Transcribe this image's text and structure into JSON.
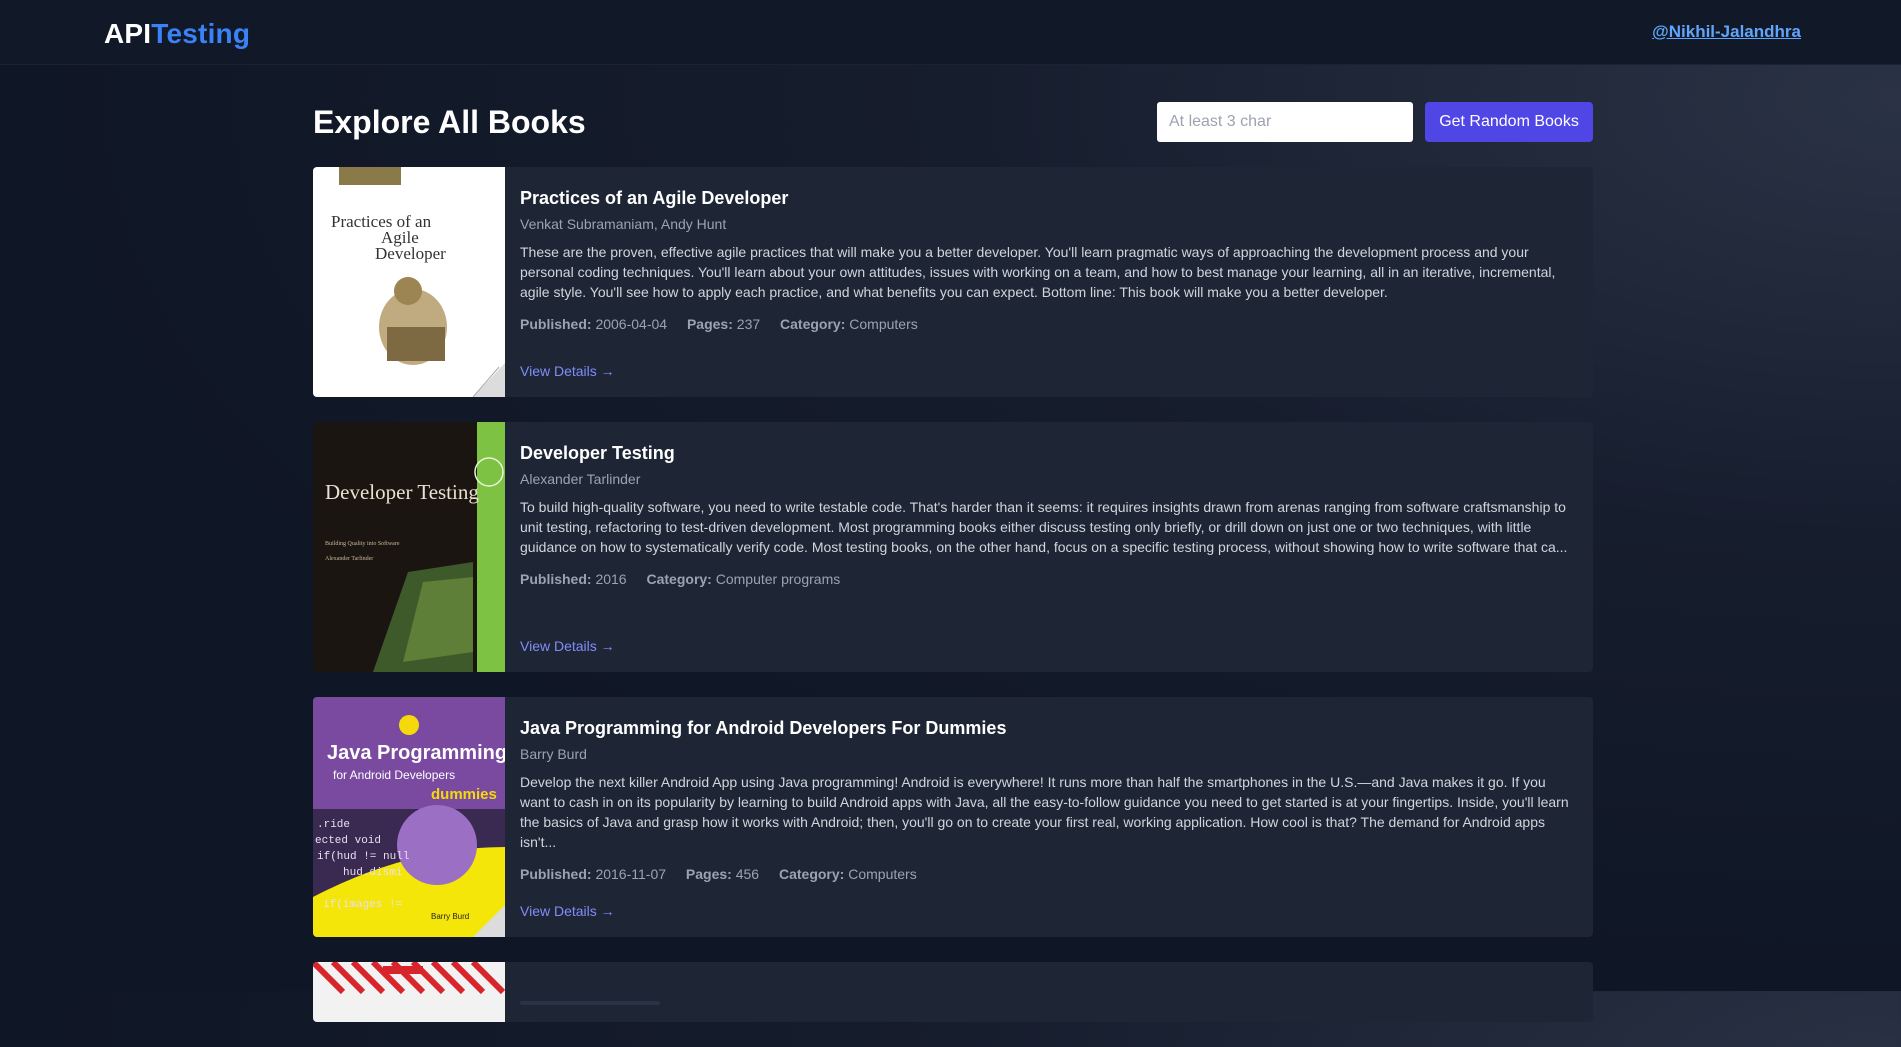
{
  "nav": {
    "brand_api": "API",
    "brand_testing": "Testing",
    "profile_link": "@Nikhil-Jalandhra"
  },
  "header": {
    "title": "Explore All Books",
    "search_placeholder": "At least 3 char",
    "random_button": "Get Random Books"
  },
  "labels": {
    "published": "Published:",
    "pages": "Pages:",
    "category": "Category:",
    "view_details": "View Details →"
  },
  "books": [
    {
      "title": "Practices of an Agile Developer",
      "authors": "Venkat Subramaniam, Andy Hunt",
      "description": "These are the proven, effective agile practices that will make you a better developer. You'll learn pragmatic ways of approaching the development process and your personal coding techniques. You'll learn about your own attitudes, issues with working on a team, and how to best manage your learning, all in an iterative, incremental, agile style. You'll see how to apply each practice, and what benefits you can expect. Bottom line: This book will make you a better developer.",
      "published": "2006-04-04",
      "pages": "237",
      "category": "Computers",
      "cover_text": "Practices of an Agile Developer"
    },
    {
      "title": "Developer Testing",
      "authors": "Alexander Tarlinder",
      "description": "To build high-quality software, you need to write testable code. That's harder than it seems: it requires insights drawn from arenas ranging from software craftsmanship to unit testing, refactoring to test-driven development. Most programming books either discuss testing only briefly, or drill down on just one or two techniques, with little guidance on how to systematically verify code. Most testing books, on the other hand, focus on a specific testing process, without showing how to write software that ca...",
      "published": "2016",
      "category": "Computer programs",
      "cover_text": "Developer Testing",
      "cover_subtitle": "Building Quality into Software",
      "cover_author": "Alexander Tarlinder"
    },
    {
      "title": "Java Programming for Android Developers For Dummies",
      "authors": "Barry Burd",
      "description": "Develop the next killer Android App using Java programming! Android is everywhere! It runs more than half the smartphones in the U.S.—and Java makes it go. If you want to cash in on its popularity by learning to build Android apps with Java, all the easy-to-follow guidance you need to get started is at your fingertips. Inside, you'll learn the basics of Java and grasp how it works with Android; then, you'll go on to create your first real, working application. How cool is that? The demand for Android apps isn't...",
      "published": "2016-11-07",
      "pages": "456",
      "category": "Computers",
      "cover_title": "Java Programming",
      "cover_subtitle": "for Android Developers",
      "cover_dummies": "dummies",
      "cover_author": "Barry Burd"
    }
  ]
}
